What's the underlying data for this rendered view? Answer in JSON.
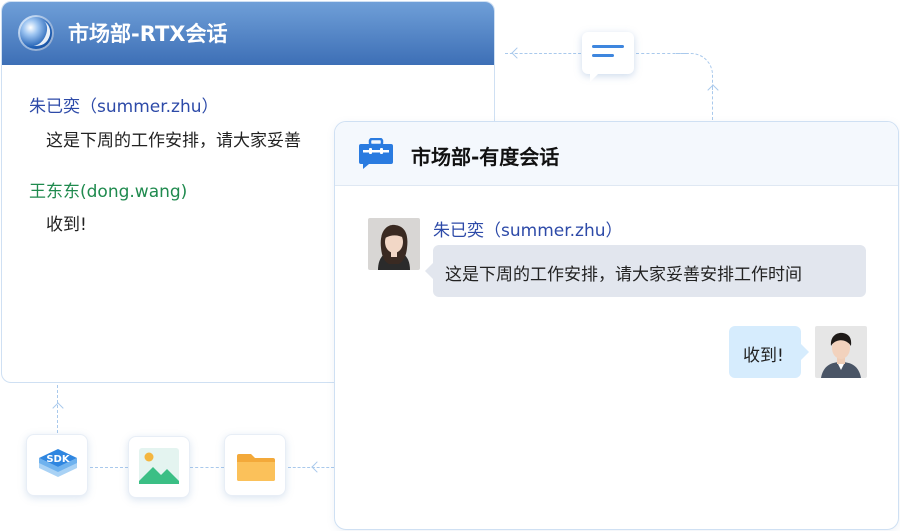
{
  "rtx_window": {
    "title": "市场部-RTX会话",
    "messages": [
      {
        "sender": "朱已奕（summer.zhu）",
        "text": "这是下周的工作安排，请大家妥善"
      },
      {
        "sender": "王东东(dong.wang)",
        "text": "收到!"
      }
    ]
  },
  "youdu_window": {
    "title": "市场部-有度会话",
    "messages": [
      {
        "sender": "朱已奕（summer.zhu）",
        "text": "这是下周的工作安排，请大家妥善安排工作时间"
      },
      {
        "sender": "",
        "text": "收到!"
      }
    ]
  },
  "icons": {
    "sdk_label": "SDK",
    "tiles": [
      "sdk-icon",
      "image-icon",
      "folder-icon"
    ],
    "sync": "chat-bubble-icon"
  },
  "colors": {
    "rtx_header_top": "#6f9fd8",
    "rtx_header_bottom": "#3d6fb6",
    "rtx_sender_blue": "#2d4aa8",
    "rtx_sender_green": "#1f8a4e",
    "youdu_header_bg": "#f4f8fd",
    "incoming_bubble": "#e2e6ee",
    "outgoing_bubble": "#d6ecfd",
    "connector": "#a9c9ec",
    "accent_blue": "#3e86de"
  }
}
